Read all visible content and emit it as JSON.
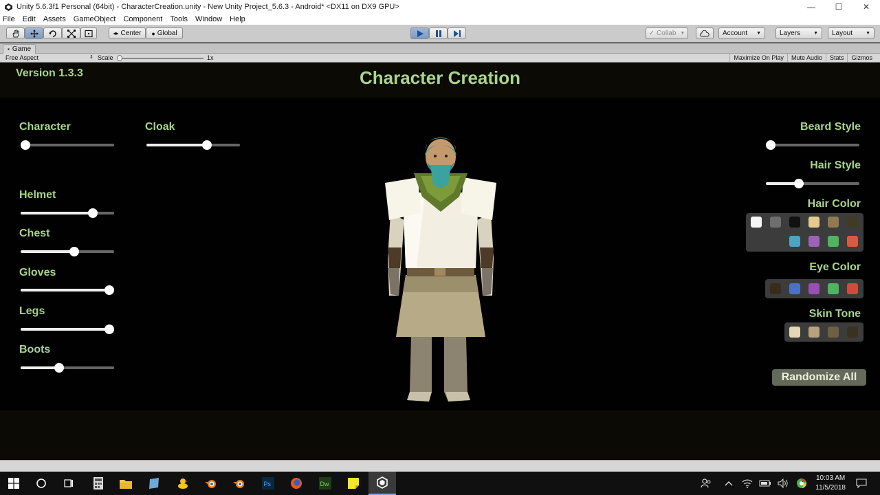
{
  "window": {
    "title": "Unity 5.6.3f1 Personal (64bit) - CharacterCreation.unity - New Unity Project_5.6.3 - Android* <DX11 on DX9 GPU>",
    "min": "—",
    "max": "☐",
    "close": "✕"
  },
  "menu": [
    "File",
    "Edit",
    "Assets",
    "GameObject",
    "Component",
    "Tools",
    "Window",
    "Help"
  ],
  "toolbar": {
    "center": "Center",
    "global": "Global",
    "collab": "Collab",
    "account": "Account",
    "layers": "Layers",
    "layout": "Layout",
    "dd": "▼"
  },
  "game_tab": {
    "label": "Game",
    "aspect": "Free Aspect",
    "scale_label": "Scale",
    "scale_value": "1x",
    "maximize": "Maximize On Play",
    "mute": "Mute Audio",
    "stats": "Stats",
    "gizmos": "Gizmos"
  },
  "game": {
    "version": "Version 1.3.3",
    "title": "Character Creation",
    "left_sliders": [
      {
        "label": "Character",
        "value": 0.05
      },
      {
        "label": "Cloak",
        "value": 0.65
      },
      {
        "label": "Helmet",
        "value": 0.77
      },
      {
        "label": "Chest",
        "value": 0.57
      },
      {
        "label": "Gloves",
        "value": 0.95
      },
      {
        "label": "Legs",
        "value": 0.95
      },
      {
        "label": "Boots",
        "value": 0.41
      }
    ],
    "right_sliders": [
      {
        "label": "Beard Style",
        "value": 0.05
      },
      {
        "label": "Hair Style",
        "value": 0.35
      }
    ],
    "hair_color": {
      "label": "Hair Color",
      "colors": [
        "#f5f5f5",
        "#6e6e6e",
        "#111111",
        "#e6cc8c",
        "#8f7a52",
        "#413a26",
        "#4fa3c4",
        "#9a63b5",
        "#4fb364",
        "#d85b3f"
      ]
    },
    "eye_color": {
      "label": "Eye Color",
      "colors": [
        "#3a2b1a",
        "#4a72c4",
        "#9a4fb5",
        "#4fb364",
        "#d24a3f"
      ]
    },
    "skin_tone": {
      "label": "Skin Tone",
      "colors": [
        "#e5d6b8",
        "#b8a27c",
        "#6e6042",
        "#3a3220"
      ]
    },
    "randomize": "Randomize All"
  },
  "taskbar": {
    "time": "10:03 AM",
    "date": "11/5/2018"
  }
}
